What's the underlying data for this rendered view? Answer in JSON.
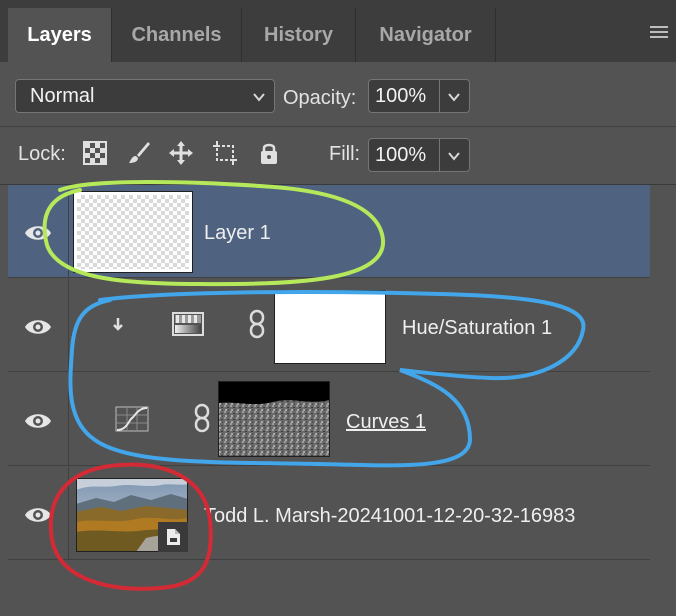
{
  "tabs": [
    {
      "label": "Layers",
      "active": true
    },
    {
      "label": "Channels",
      "active": false
    },
    {
      "label": "History",
      "active": false
    },
    {
      "label": "Navigator",
      "active": false
    }
  ],
  "panel_menu_icon": "hamburger-menu-icon",
  "blend": {
    "mode": "Normal",
    "opacity_label": "Opacity:",
    "opacity_value": "100%"
  },
  "lock": {
    "label": "Lock:",
    "icons": [
      "lock-transparent-pixels-icon",
      "lock-image-pixels-icon",
      "lock-position-icon",
      "lock-artboard-icon",
      "lock-all-icon"
    ],
    "fill_label": "Fill:",
    "fill_value": "100%"
  },
  "layers": [
    {
      "name": "Layer 1",
      "selected": true,
      "visible": true,
      "kind": "pixel"
    },
    {
      "name": "Hue/Saturation 1",
      "selected": false,
      "visible": true,
      "kind": "hue-saturation-adjustment",
      "clipped": true
    },
    {
      "name": "Curves 1",
      "selected": false,
      "visible": true,
      "kind": "curves-adjustment"
    },
    {
      "name": "Todd L. Marsh-20241001-12-20-32-16983",
      "selected": false,
      "visible": true,
      "kind": "smart-object"
    }
  ],
  "colors": {
    "panel_bg": "#535353",
    "tab_bar_bg": "#3d3d3d",
    "selected_row": "#4f6280",
    "annotation_green": "#b5e85a",
    "annotation_blue": "#43a6ea",
    "annotation_red": "#d42a35"
  }
}
